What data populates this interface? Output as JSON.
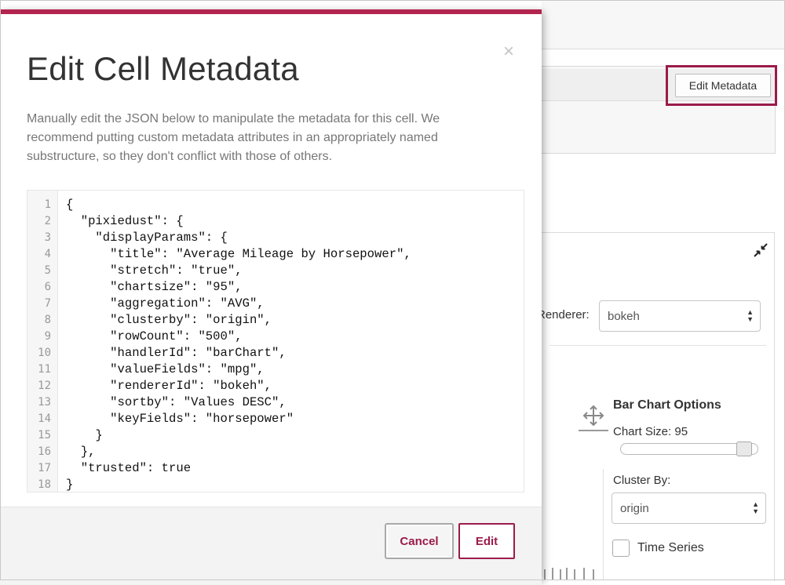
{
  "modal": {
    "title": "Edit Cell Metadata",
    "close_label": "×",
    "description": "Manually edit the JSON below to manipulate the metadata for this cell. We recommend putting custom metadata attributes in an appropriately named substructure, so they don't conflict with those of others.",
    "line_numbers": [
      "1",
      "2",
      "3",
      "4",
      "5",
      "6",
      "7",
      "8",
      "9",
      "10",
      "11",
      "12",
      "13",
      "14",
      "15",
      "16",
      "17",
      "18"
    ],
    "code_lines": [
      "{",
      "  \"pixiedust\": {",
      "    \"displayParams\": {",
      "      \"title\": \"Average Mileage by Horsepower\",",
      "      \"stretch\": \"true\",",
      "      \"chartsize\": \"95\",",
      "      \"aggregation\": \"AVG\",",
      "      \"clusterby\": \"origin\",",
      "      \"rowCount\": \"500\",",
      "      \"handlerId\": \"barChart\",",
      "      \"valueFields\": \"mpg\",",
      "      \"rendererId\": \"bokeh\",",
      "      \"sortby\": \"Values DESC\",",
      "      \"keyFields\": \"horsepower\"",
      "    }",
      "  },",
      "  \"trusted\": true",
      "}"
    ],
    "cancel_label": "Cancel",
    "edit_label": "Edit"
  },
  "notebook": {
    "edit_metadata_label": "Edit Metadata",
    "renderer_label": "Renderer:",
    "renderer_value": "bokeh",
    "options_title": "Bar Chart Options",
    "chart_size_label": "Chart Size: 95",
    "chart_size_value": 95,
    "cluster_by_label": "Cluster By:",
    "cluster_by_value": "origin",
    "time_series_label": "Time Series",
    "time_series_checked": false
  },
  "colors": {
    "accent": "#9b1b4a",
    "modal_top_border": "#b3244f",
    "description_text": "#777777",
    "gutter_bg": "#f6f6f6"
  },
  "icons": {
    "close": "close-icon",
    "collapse": "collapse-arrows-icon",
    "move": "move-arrows-icon",
    "select_arrows": "select-arrows-icon"
  }
}
